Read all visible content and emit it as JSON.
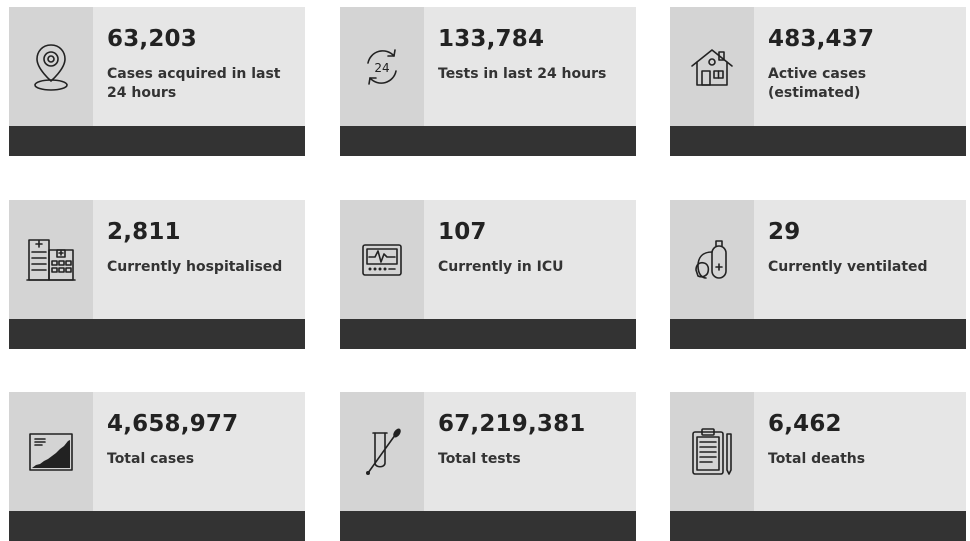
{
  "cards": [
    {
      "value": "63,203",
      "label": "Cases acquired in last 24 hours",
      "icon": "location-pin-icon"
    },
    {
      "value": "133,784",
      "label": "Tests in last 24 hours",
      "icon": "24-hour-cycle-icon"
    },
    {
      "value": "483,437",
      "label": "Active cases (estimated)",
      "icon": "house-icon"
    },
    {
      "value": "2,811",
      "label": "Currently hospitalised",
      "icon": "hospital-building-icon"
    },
    {
      "value": "107",
      "label": "Currently in ICU",
      "icon": "heart-monitor-icon"
    },
    {
      "value": "29",
      "label": "Currently ventilated",
      "icon": "oxygen-tank-icon"
    },
    {
      "value": "4,658,977",
      "label": "Total cases",
      "icon": "growth-chart-icon"
    },
    {
      "value": "67,219,381",
      "label": "Total tests",
      "icon": "swab-test-tube-icon"
    },
    {
      "value": "6,462",
      "label": "Total deaths",
      "icon": "clipboard-icon"
    }
  ],
  "colors": {
    "card_bg": "#e6e6e6",
    "icon_col_bg": "#d4d4d4",
    "footer_bar": "#333333"
  }
}
